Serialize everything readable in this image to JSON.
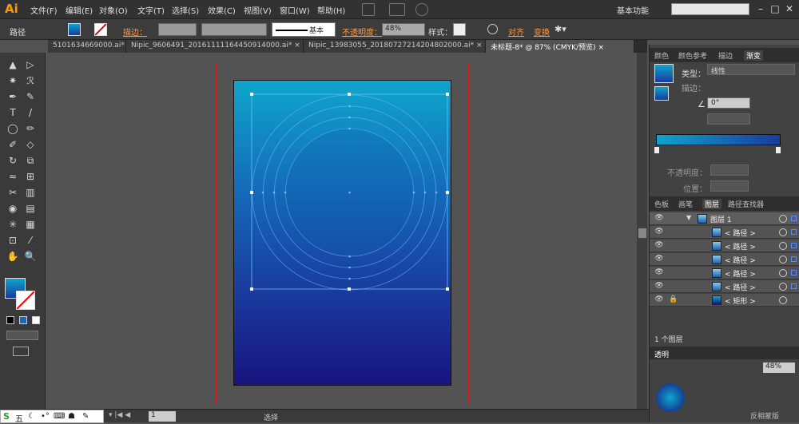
{
  "menubar": {
    "logo": "Ai",
    "items": [
      "文件(F)",
      "编辑(E)",
      "对象(O)",
      "文字(T)",
      "选择(S)",
      "效果(C)",
      "视图(V)",
      "窗口(W)",
      "帮助(H)"
    ],
    "workspace": "基本功能",
    "window_buttons": [
      "–",
      "□",
      "✕"
    ]
  },
  "control_bar": {
    "object_label": "路径",
    "stroke_label": "描边：",
    "brush_label": "基本",
    "opacity_label": "不透明度：",
    "opacity_value": "48%",
    "style_label": "样式：",
    "align_label": "对齐",
    "transform_label": "变换"
  },
  "tabs": [
    {
      "label": "5101634669000.ai*",
      "close": "×"
    },
    {
      "label": "Nipic_9606491_20161111164450914000.ai*",
      "close": "×"
    },
    {
      "label": "Nipic_13983055_20180727214204802000.ai*",
      "close": "×"
    },
    {
      "label": "未标题-8* @ 87% (CMYK/预览)",
      "close": "×"
    }
  ],
  "tools": [
    "▲",
    "▷",
    "✷",
    "ℛ",
    "✒",
    "✎",
    "T",
    "/",
    "◯",
    "✏",
    "✐",
    "◇",
    "↻",
    "⧉",
    "≈",
    "⊞",
    "✂",
    "▥",
    "◉",
    "▤",
    "✳",
    "▦",
    "⊡",
    "⁄",
    "✋",
    "🔍"
  ],
  "right_panel": {
    "top_tabs": [
      "颜色",
      "颜色参考",
      "描边",
      "渐变"
    ],
    "type_label": "类型：",
    "type_value": "线性",
    "stroke_label": "描边：",
    "angle_value": "0°",
    "opacity_label": "不透明度：",
    "position_label": "位置：",
    "layer_tabs": [
      "色板",
      "画笔",
      "图层",
      "路径查找器"
    ],
    "layers": [
      {
        "name": "图层 1",
        "indent": 0
      },
      {
        "name": "< 路径 >",
        "indent": 1
      },
      {
        "name": "< 路径 >",
        "indent": 1
      },
      {
        "name": "< 路径 >",
        "indent": 1
      },
      {
        "name": "< 路径 >",
        "indent": 1
      },
      {
        "name": "< 路径 >",
        "indent": 1
      },
      {
        "name": "< 矩形 >",
        "indent": 1
      }
    ],
    "layer_count": "1 个图层",
    "bottom_tabs": [
      "透明"
    ],
    "opacity_value": "48%",
    "knockout_label": "反相蒙版"
  },
  "statusbar": {
    "zoom_value": "1",
    "mode_label": "选择",
    "ime_items": [
      "五",
      "☾",
      "•°",
      "⌨",
      "☗",
      "✎"
    ]
  },
  "colors": {
    "accent_orange": "#ff9a3a",
    "gradient_top": "#0ea5cc",
    "gradient_bottom": "#18147e",
    "artboard_border": "#d62020"
  }
}
